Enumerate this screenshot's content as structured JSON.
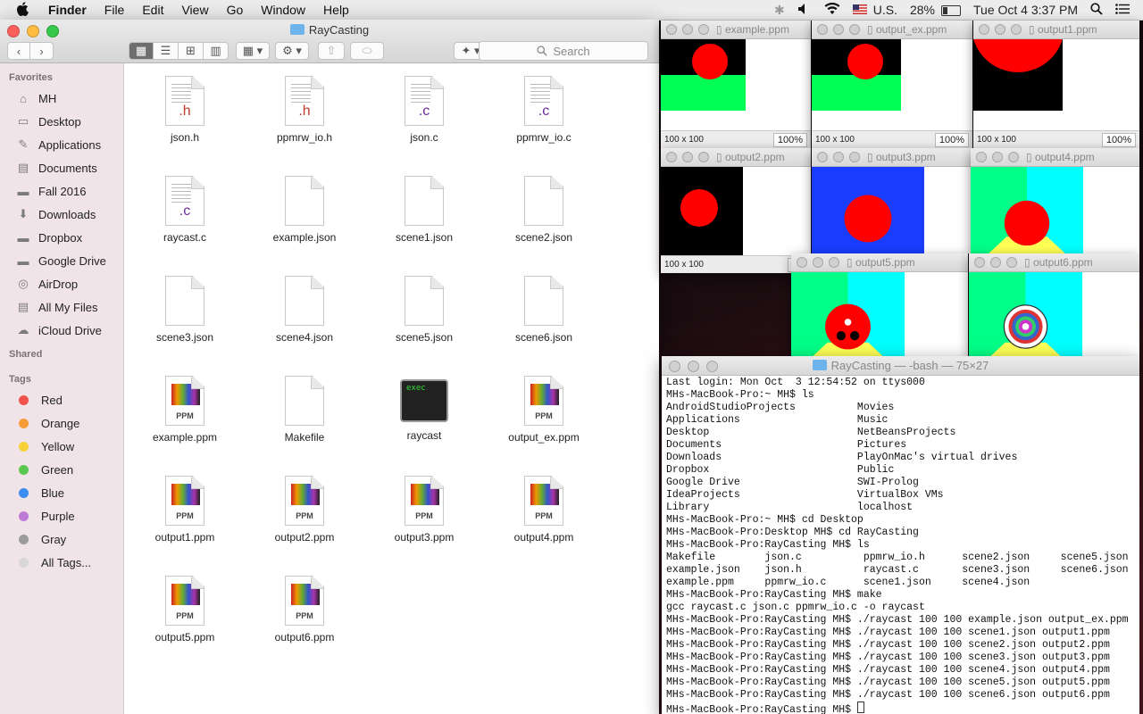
{
  "menubar": {
    "app": "Finder",
    "items": [
      "File",
      "Edit",
      "View",
      "Go",
      "Window",
      "Help"
    ],
    "input_source": "U.S.",
    "battery_pct": "28%",
    "battery_level": 0.28,
    "clock": "Tue Oct 4  3:37 PM"
  },
  "finder": {
    "title": "RayCasting",
    "search_placeholder": "Search",
    "sidebar": {
      "favorites_label": "Favorites",
      "favorites": [
        {
          "label": "MH",
          "icon": "home-icon"
        },
        {
          "label": "Desktop",
          "icon": "desktop-icon"
        },
        {
          "label": "Applications",
          "icon": "applications-icon"
        },
        {
          "label": "Documents",
          "icon": "documents-icon"
        },
        {
          "label": "Fall 2016",
          "icon": "folder-icon"
        },
        {
          "label": "Downloads",
          "icon": "downloads-icon"
        },
        {
          "label": "Dropbox",
          "icon": "folder-icon"
        },
        {
          "label": "Google Drive",
          "icon": "folder-icon"
        },
        {
          "label": "AirDrop",
          "icon": "airdrop-icon"
        },
        {
          "label": "All My Files",
          "icon": "all-files-icon"
        },
        {
          "label": "iCloud Drive",
          "icon": "cloud-icon"
        }
      ],
      "shared_label": "Shared",
      "tags_label": "Tags",
      "tags": [
        {
          "label": "Red",
          "color": "#f2524c"
        },
        {
          "label": "Orange",
          "color": "#f59c36"
        },
        {
          "label": "Yellow",
          "color": "#f6d13a"
        },
        {
          "label": "Green",
          "color": "#5ac84e"
        },
        {
          "label": "Blue",
          "color": "#3c8ef2"
        },
        {
          "label": "Purple",
          "color": "#bc7ad6"
        },
        {
          "label": "Gray",
          "color": "#9b9b9b"
        },
        {
          "label": "All Tags...",
          "color": "#d8d8d8"
        }
      ]
    },
    "files": [
      {
        "name": "json.h",
        "kind": "h",
        "ext": ".h"
      },
      {
        "name": "ppmrw_io.h",
        "kind": "h",
        "ext": ".h"
      },
      {
        "name": "json.c",
        "kind": "c",
        "ext": ".c"
      },
      {
        "name": "ppmrw_io.c",
        "kind": "c",
        "ext": ".c"
      },
      {
        "name": "raycast.c",
        "kind": "c",
        "ext": ".c"
      },
      {
        "name": "example.json",
        "kind": "blank",
        "ext": ""
      },
      {
        "name": "scene1.json",
        "kind": "blank",
        "ext": ""
      },
      {
        "name": "scene2.json",
        "kind": "blank",
        "ext": ""
      },
      {
        "name": "scene3.json",
        "kind": "blank",
        "ext": ""
      },
      {
        "name": "scene4.json",
        "kind": "blank",
        "ext": ""
      },
      {
        "name": "scene5.json",
        "kind": "blank",
        "ext": ""
      },
      {
        "name": "scene6.json",
        "kind": "blank",
        "ext": ""
      },
      {
        "name": "example.ppm",
        "kind": "ppm",
        "ext": "PPM"
      },
      {
        "name": "Makefile",
        "kind": "blank",
        "ext": ""
      },
      {
        "name": "raycast",
        "kind": "exec",
        "ext": "exec"
      },
      {
        "name": "output_ex.ppm",
        "kind": "ppm",
        "ext": "PPM"
      },
      {
        "name": "output1.ppm",
        "kind": "ppm",
        "ext": "PPM"
      },
      {
        "name": "output2.ppm",
        "kind": "ppm",
        "ext": "PPM"
      },
      {
        "name": "output3.ppm",
        "kind": "ppm",
        "ext": "PPM"
      },
      {
        "name": "output4.ppm",
        "kind": "ppm",
        "ext": "PPM"
      },
      {
        "name": "output5.ppm",
        "kind": "ppm",
        "ext": "PPM"
      },
      {
        "name": "output6.ppm",
        "kind": "ppm",
        "ext": "PPM"
      }
    ]
  },
  "previews": [
    {
      "title": "example.ppm",
      "status": "100 x 100",
      "zoom": "100%"
    },
    {
      "title": "output_ex.ppm",
      "status": "100 x 100",
      "zoom": "100%"
    },
    {
      "title": "output1.ppm",
      "status": "100 x 100",
      "zoom": "100%"
    },
    {
      "title": "output2.ppm",
      "status": "100 x 100",
      "zoom": "10"
    },
    {
      "title": "output3.ppm"
    },
    {
      "title": "output4.ppm"
    },
    {
      "title": "output5.ppm"
    },
    {
      "title": "output6.ppm"
    }
  ],
  "terminal": {
    "title": "RayCasting — -bash — 75×27",
    "lines": [
      "Last login: Mon Oct  3 12:54:52 on ttys000",
      "MHs-MacBook-Pro:~ MH$ ls",
      "AndroidStudioProjects          Movies",
      "Applications                   Music",
      "Desktop                        NetBeansProjects",
      "Documents                      Pictures",
      "Downloads                      PlayOnMac's virtual drives",
      "Dropbox                        Public",
      "Google Drive                   SWI-Prolog",
      "IdeaProjects                   VirtualBox VMs",
      "Library                        localhost",
      "MHs-MacBook-Pro:~ MH$ cd Desktop",
      "MHs-MacBook-Pro:Desktop MH$ cd RayCasting",
      "MHs-MacBook-Pro:RayCasting MH$ ls",
      "Makefile        json.c          ppmrw_io.h      scene2.json     scene5.json",
      "example.json    json.h          raycast.c       scene3.json     scene6.json",
      "example.ppm     ppmrw_io.c      scene1.json     scene4.json",
      "MHs-MacBook-Pro:RayCasting MH$ make",
      "gcc raycast.c json.c ppmrw_io.c -o raycast",
      "MHs-MacBook-Pro:RayCasting MH$ ./raycast 100 100 example.json output_ex.ppm",
      "MHs-MacBook-Pro:RayCasting MH$ ./raycast 100 100 scene1.json output1.ppm",
      "MHs-MacBook-Pro:RayCasting MH$ ./raycast 100 100 scene2.json output2.ppm",
      "MHs-MacBook-Pro:RayCasting MH$ ./raycast 100 100 scene3.json output3.ppm",
      "MHs-MacBook-Pro:RayCasting MH$ ./raycast 100 100 scene4.json output4.ppm",
      "MHs-MacBook-Pro:RayCasting MH$ ./raycast 100 100 scene5.json output5.ppm",
      "MHs-MacBook-Pro:RayCasting MH$ ./raycast 100 100 scene6.json output6.ppm",
      "MHs-MacBook-Pro:RayCasting MH$ "
    ]
  }
}
